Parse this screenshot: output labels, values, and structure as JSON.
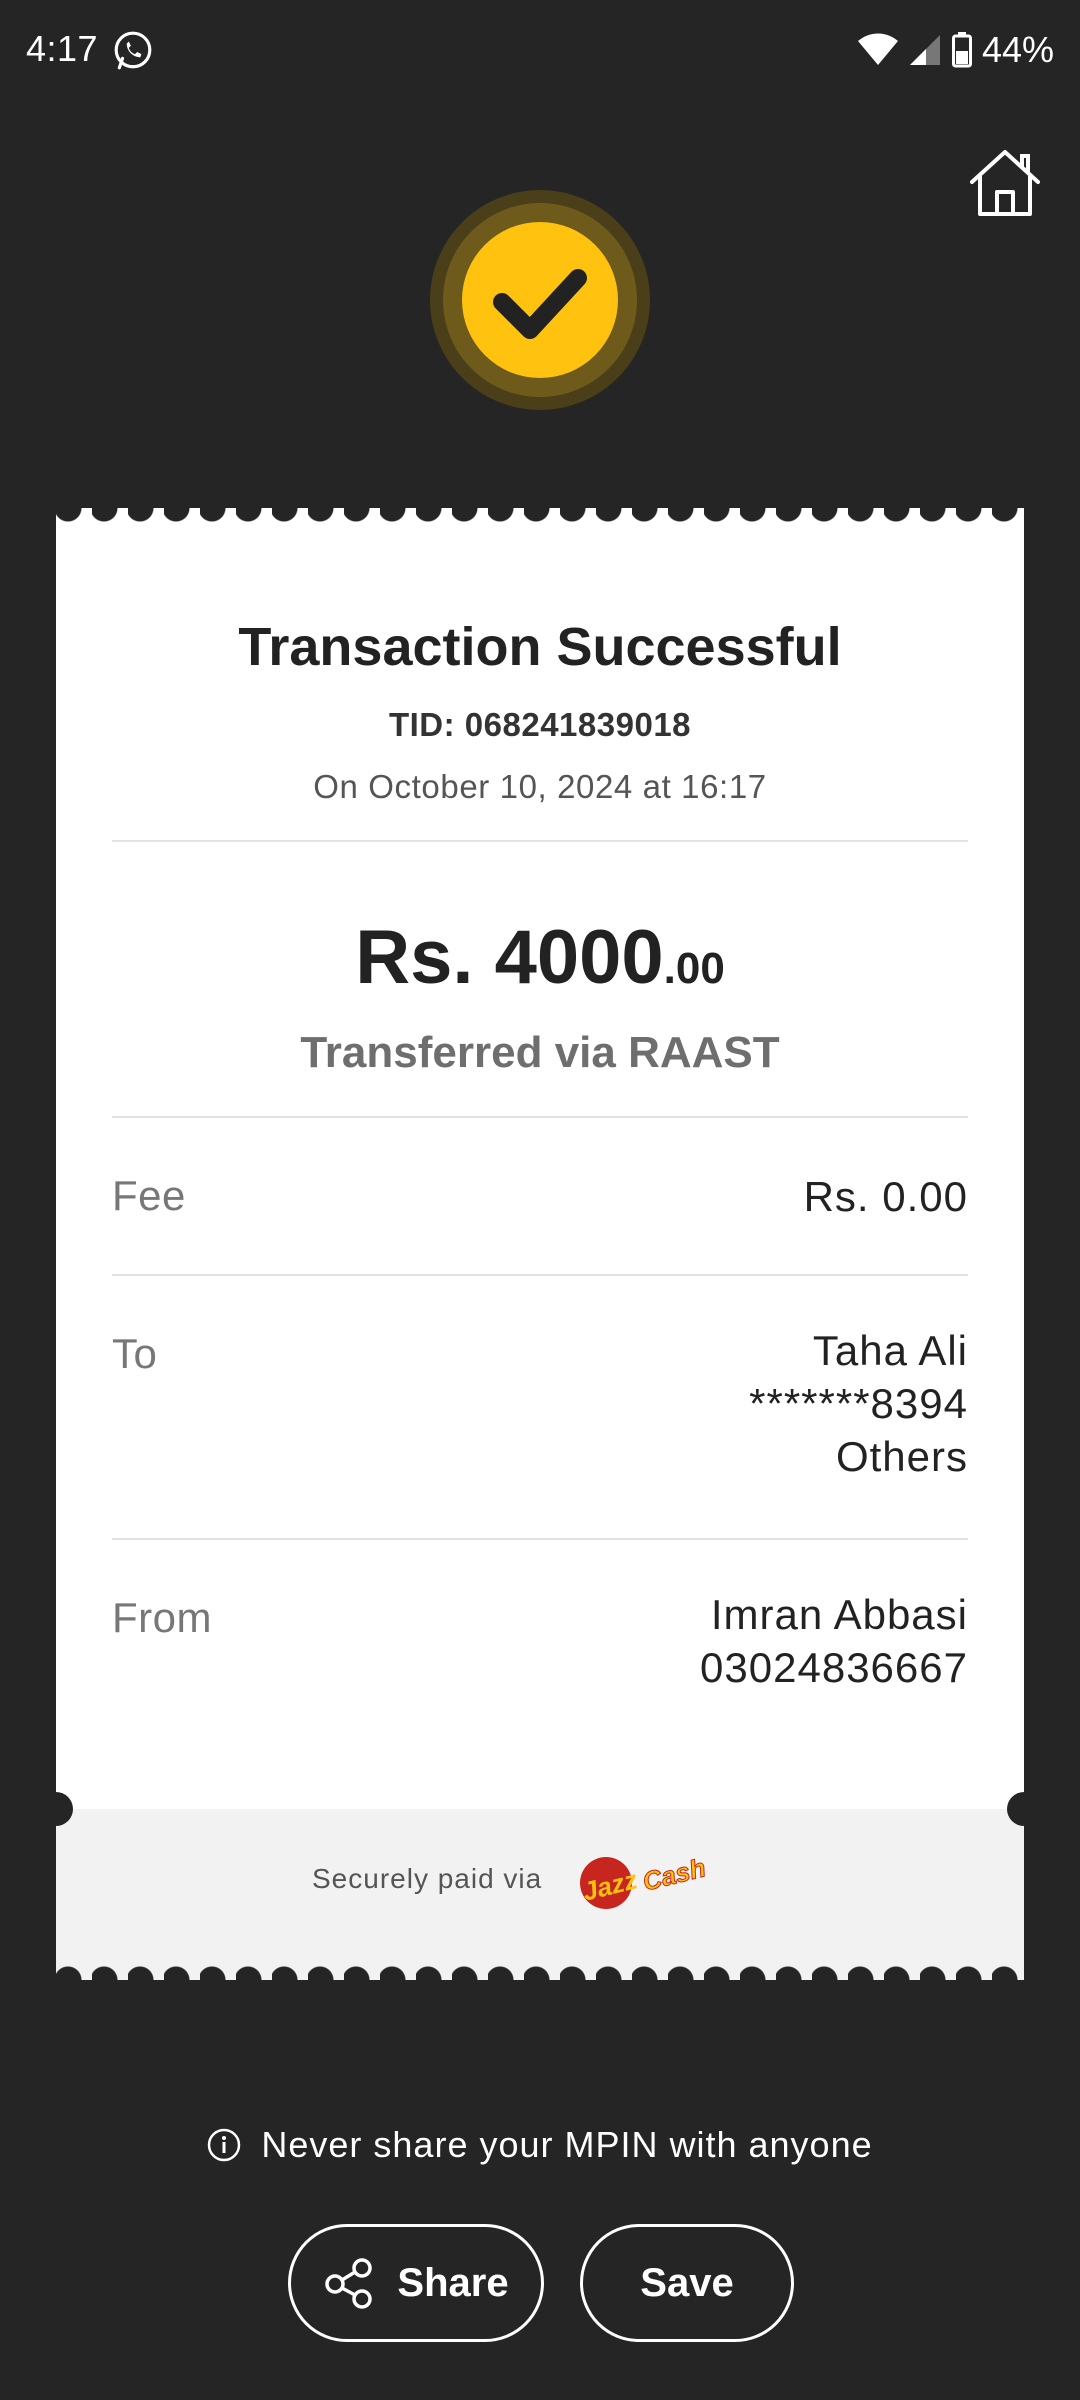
{
  "status_bar": {
    "time": "4:17",
    "battery_text": "44%",
    "icons": [
      "whatsapp-icon",
      "wifi-icon",
      "signal-icon",
      "battery-icon"
    ]
  },
  "receipt": {
    "title": "Transaction Successful",
    "tid": "TID: 068241839018",
    "datetime": "On October 10, 2024 at 16:17",
    "amount_main": "Rs. 4000",
    "amount_decimal": ".00",
    "transfer_method": "Transferred via RAAST",
    "fee": {
      "label": "Fee",
      "value": "Rs. 0.00"
    },
    "to": {
      "label": "To",
      "name": "Taha Ali",
      "account": "*******8394",
      "bank": "Others"
    },
    "from": {
      "label": "From",
      "name": "Imran Abbasi",
      "number": "03024836667"
    },
    "footer_text": "Securely paid via",
    "brand_logo": "JazzCash"
  },
  "notice": "Never share your MPIN with anyone",
  "buttons": {
    "share": "Share",
    "save": "Save"
  },
  "colors": {
    "background": "#252525",
    "accent": "#FFC20E",
    "card": "#ffffff",
    "card_footer": "#f2f2f2"
  }
}
